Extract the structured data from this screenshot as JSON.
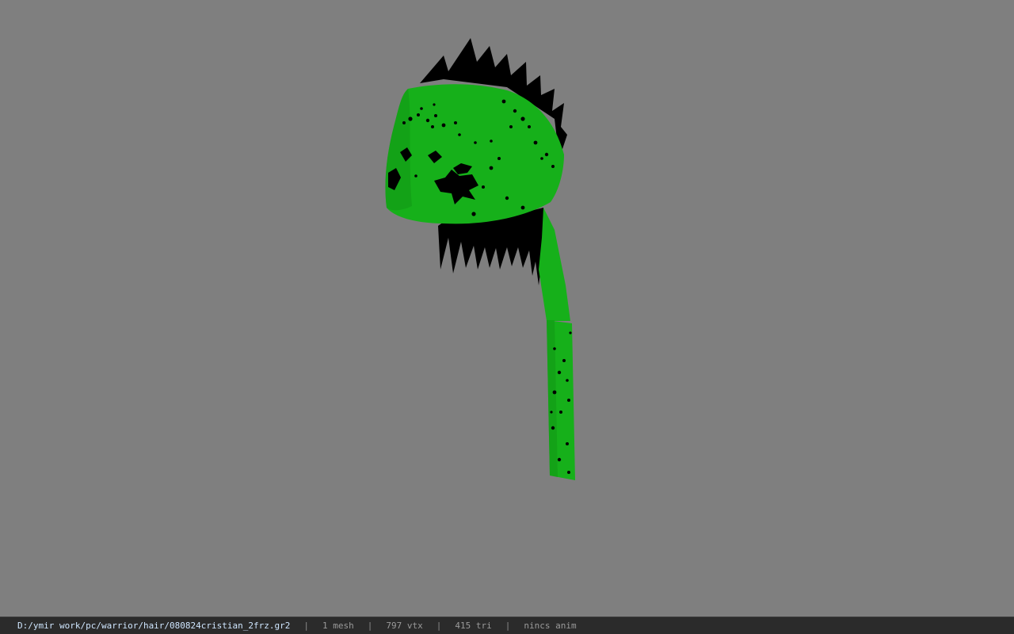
{
  "viewport": {
    "background_color": "#7f7f7f",
    "model": {
      "name": "hair-mesh",
      "body_color": "#16b01a",
      "spike_color": "#000000"
    }
  },
  "status_bar": {
    "file_path": "D:/ymir work/pc/warrior/hair/080824cristian_2frz.gr2",
    "separator": "|",
    "mesh_count": "1 mesh",
    "vertex_count": "797 vtx",
    "triangle_count": "415 tri",
    "anim_status": "nincs anim"
  }
}
